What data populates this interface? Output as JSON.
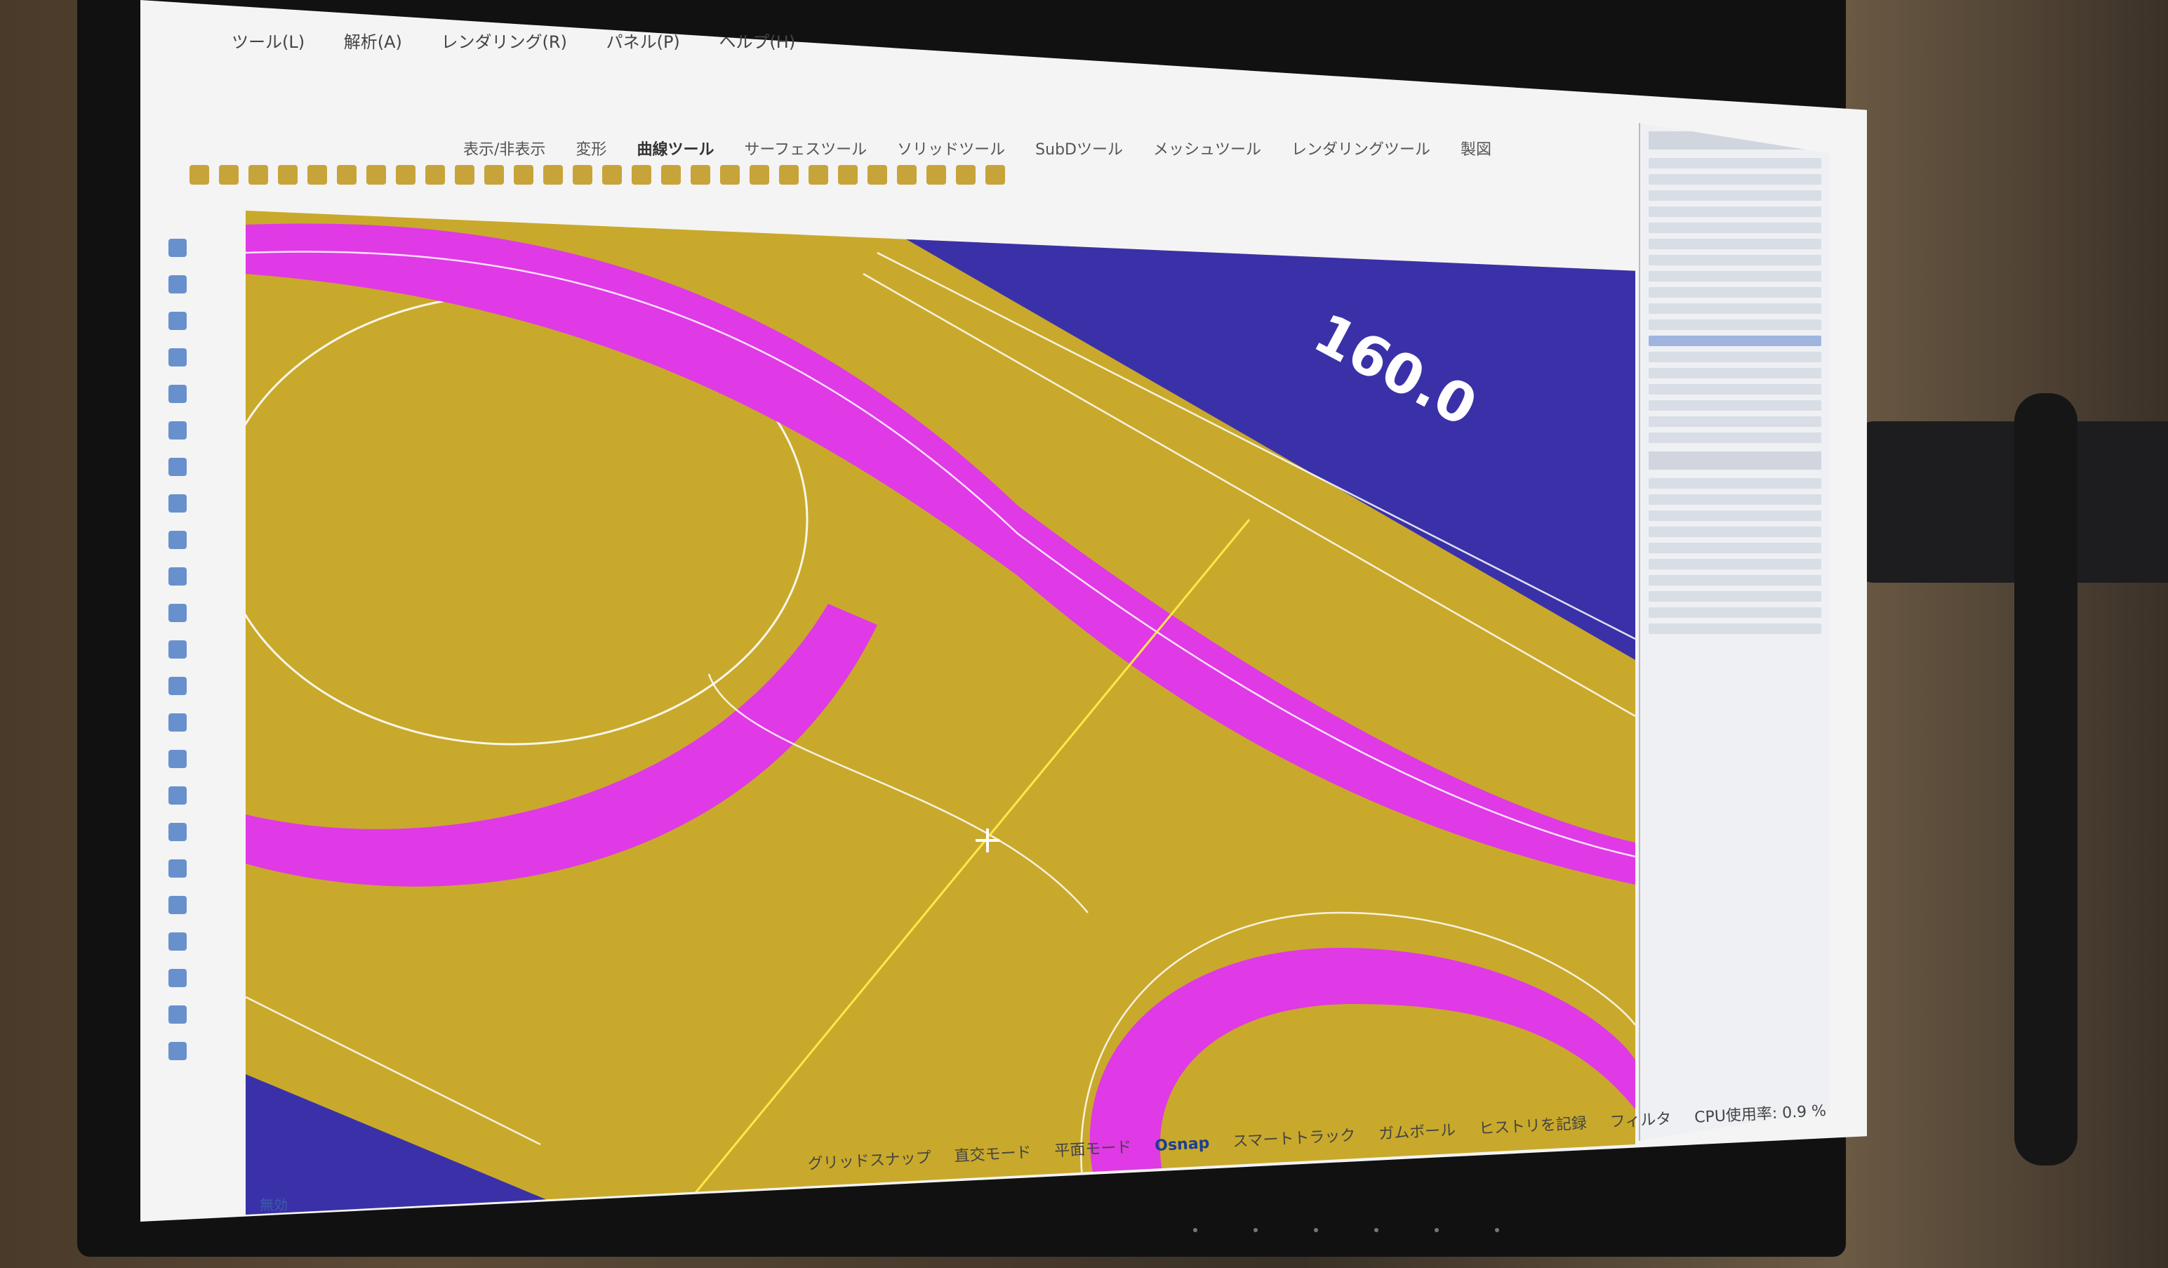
{
  "app": {
    "menu": [
      "ツール(L)",
      "解析(A)",
      "レンダリング(R)",
      "パネル(P)",
      "ヘルプ(H)"
    ],
    "toolbar_tabs": [
      "表示/非表示",
      "変形",
      "曲線ツール",
      "サーフェスツール",
      "ソリッドツール",
      "SubDツール",
      "メッシュツール",
      "レンダリングツール",
      "製図"
    ],
    "active_tab": "曲線ツール"
  },
  "viewport": {
    "dimension_label": "160.0",
    "colors": {
      "background": "#c9a92b",
      "dark_region": "#3a31a8",
      "highlight_surface": "#e039e6",
      "edge_lines": "#ffffff"
    }
  },
  "statusbar": {
    "items": [
      "グリッドスナップ",
      "直交モード",
      "平面モード",
      "Osnap",
      "スマートトラック",
      "ガムボール",
      "ヒストリを記録",
      "フィルタ",
      "CPU使用率: 0.9 %"
    ],
    "active": [
      "Osnap"
    ],
    "top_label": "無効"
  }
}
